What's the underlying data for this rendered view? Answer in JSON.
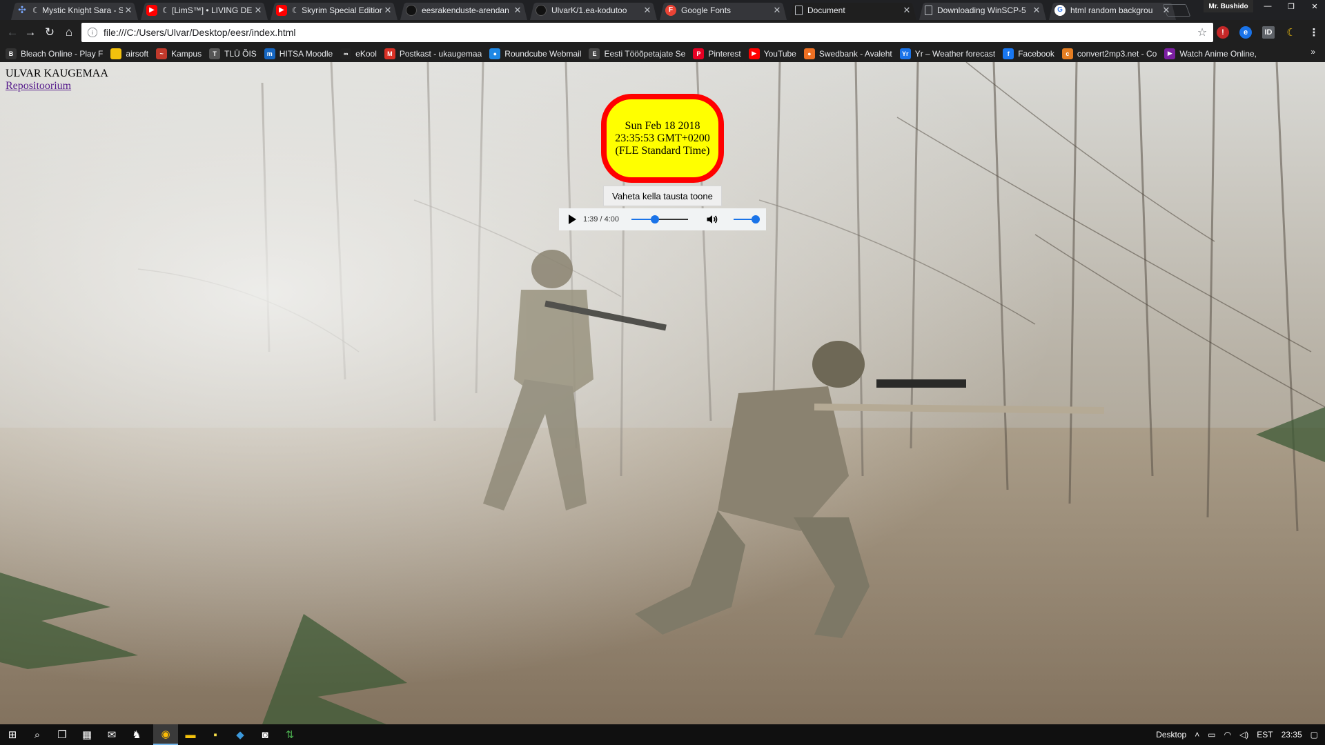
{
  "browser": {
    "tabs": [
      {
        "title": "☾ Mystic Knight Sara - Sh",
        "icon": "fandom-icon",
        "active": false
      },
      {
        "title": "☾ [LimS™] • LIVING DE",
        "icon": "youtube-icon",
        "active": false
      },
      {
        "title": "☾ Skyrim Special Edition",
        "icon": "youtube-icon",
        "active": false
      },
      {
        "title": "eesrakenduste-arendan",
        "icon": "github-icon",
        "active": false
      },
      {
        "title": "UlvarK/1.ea-kodutoo",
        "icon": "github-icon",
        "active": false
      },
      {
        "title": "Google Fonts",
        "icon": "google-fonts-icon",
        "active": false
      },
      {
        "title": "Document",
        "icon": "document-icon",
        "active": true
      },
      {
        "title": "Downloading WinSCP-5",
        "icon": "document-icon",
        "active": false
      },
      {
        "title": "html random backgrou",
        "icon": "google-icon",
        "active": false
      }
    ],
    "profile_name": "Mr. Bushido",
    "url": "file:///C:/Users/Ulvar/Desktop/eesr/index.html",
    "bookmarks": [
      {
        "label": "Bleach Online - Play F",
        "color": "#333333",
        "glyph": "B"
      },
      {
        "label": "airsoft",
        "color": "#f4c20d",
        "glyph": ""
      },
      {
        "label": "Kampus",
        "color": "#c0392b",
        "glyph": "~"
      },
      {
        "label": "TLÜ ÕIS",
        "color": "#555555",
        "glyph": "T"
      },
      {
        "label": "HITSA Moodle",
        "color": "#1565c0",
        "glyph": "m"
      },
      {
        "label": "eKool",
        "color": "#222222",
        "glyph": "∞"
      },
      {
        "label": "Postkast - ukaugemaa",
        "color": "#d93025",
        "glyph": "M"
      },
      {
        "label": "Roundcube Webmail",
        "color": "#1e88e5",
        "glyph": "●"
      },
      {
        "label": "Eesti Tööõpetajate Se",
        "color": "#444444",
        "glyph": "E"
      },
      {
        "label": "Pinterest",
        "color": "#e60023",
        "glyph": "P"
      },
      {
        "label": "YouTube",
        "color": "#ff0000",
        "glyph": "▶"
      },
      {
        "label": "Swedbank - Avaleht",
        "color": "#ee7023",
        "glyph": "●"
      },
      {
        "label": "Yr – Weather forecast",
        "color": "#1a73e8",
        "glyph": "Yr"
      },
      {
        "label": "Facebook",
        "color": "#1877f2",
        "glyph": "f"
      },
      {
        "label": "convert2mp3.net - Co",
        "color": "#e67e22",
        "glyph": "c"
      },
      {
        "label": "Watch Anime Online,",
        "color": "#7b1fa2",
        "glyph": "▶"
      }
    ],
    "bookmarks_more": "»"
  },
  "page": {
    "author_name": "ULVAR KAUGEMAA",
    "repo_link": "Repositoorium",
    "clock_text": "Sun Feb 18 2018 23:35:53 GMT+0200 (FLE Standard Time)",
    "button_label": "Vaheta kella tausta toone",
    "audio": {
      "time_display": "1:39 / 4:00",
      "progress": 0.41,
      "volume": 1.0
    },
    "colors": {
      "clock_bg": "#ffff00",
      "clock_border": "#ff0000",
      "link": "#551a8b"
    }
  },
  "taskbar": {
    "desktop_label": "Desktop",
    "language": "EST",
    "clock": "23:35"
  }
}
